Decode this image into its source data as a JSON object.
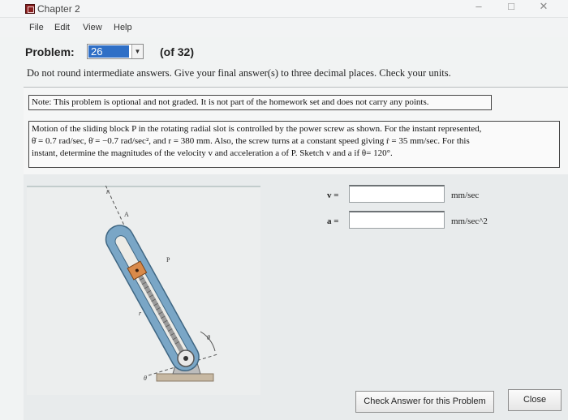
{
  "window": {
    "title": "Chapter 2",
    "controls": [
      "–",
      "□",
      "✕"
    ]
  },
  "menu": [
    "File",
    "Edit",
    "View",
    "Help"
  ],
  "problem": {
    "label": "Problem:",
    "selected": "26",
    "of_count": "(of 32)"
  },
  "instructions": "Do not round intermediate answers.  Give your final answer(s) to three decimal places.  Check your units.",
  "note": "Note: This problem is optional and not graded.  It is not part of the homework set and does not carry any points.",
  "problem_text": {
    "line1": "Motion of the sliding block P in the rotating radial slot is controlled by the power screw as shown. For the instant represented,",
    "line2": "θ̇ = 0.7 rad/sec, θ̈ = −0.7 rad/sec², and r = 380 mm. Also, the screw turns at a constant speed giving ṙ = 35 mm/sec. For this",
    "line3": "instant, determine the magnitudes of the velocity v and acceleration a of P. Sketch v and a if θ= 120°."
  },
  "figure": {
    "labels": [
      "r",
      "A",
      "P",
      "r",
      "θ",
      "θ"
    ]
  },
  "answers": [
    {
      "label": "v =",
      "value": "",
      "unit": "mm/sec"
    },
    {
      "label": "a =",
      "value": "",
      "unit": "mm/sec^2"
    }
  ],
  "buttons": {
    "check": "Check Answer for this Problem",
    "close": "Close"
  }
}
